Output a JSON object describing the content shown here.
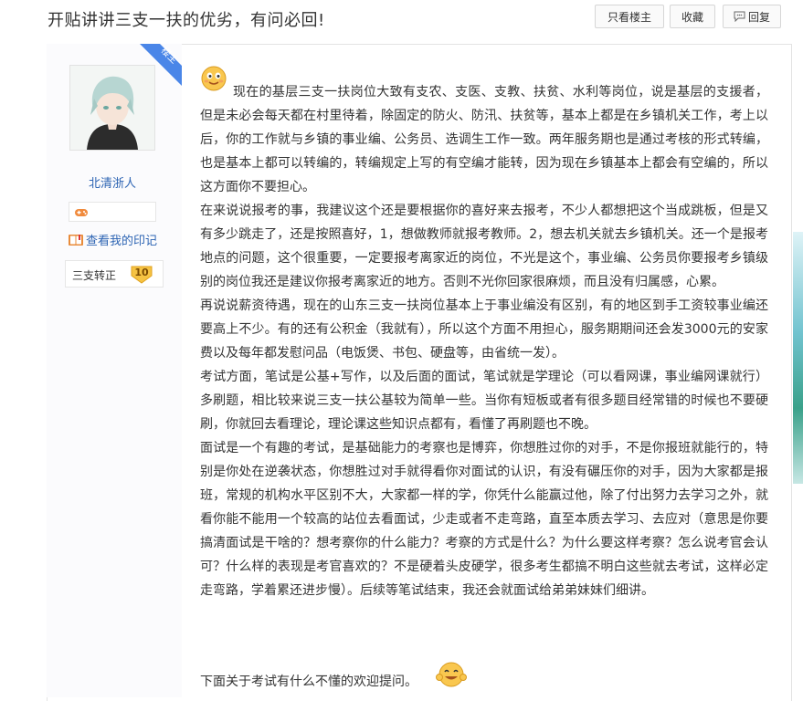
{
  "header": {
    "title": "开贴讲讲三支一扶的优劣，有问必回!",
    "only_author_label": "只看楼主",
    "favorite_label": "收藏",
    "reply_label": "回复"
  },
  "author": {
    "name": "北清浙人",
    "corner_label": "楼主",
    "marks_link": "查看我的印记",
    "badge_name": "三支转正",
    "badge_level": "10"
  },
  "post": {
    "paragraphs": [
      "现在的基层三支一扶岗位大致有支农、支医、支教、扶贫、水利等岗位，说是基层的支援者，但是未必会每天都在村里待着，除固定的防火、防汛、扶贫等，基本上都是在乡镇机关工作，考上以后，你的工作就与乡镇的事业编、公务员、选调生工作一致。两年服务期也是通过考核的形式转编，也是基本上都可以转编的，转编规定上写的有空编才能转，因为现在乡镇基本上都会有空编的，所以这方面你不要担心。",
      "在来说说报考的事，我建议这个还是要根据你的喜好来去报考，不少人都想把这个当成跳板，但是又有多少跳走了，还是按照喜好，1，想做教师就报考教师。2，想去机关就去乡镇机关。还一个是报考地点的问题，这个很重要，一定要报考离家近的岗位，不光是这个，事业编、公务员你要报考乡镇级别的岗位我还是建议你报考离家近的地方。否则不光你回家很麻烦，而且没有归属感，心累。",
      "再说说薪资待遇，现在的山东三支一扶岗位基本上于事业编没有区别，有的地区到手工资较事业编还要高上不少。有的还有公积金（我就有），所以这个方面不用担心，服务期期间还会发3000元的安家费以及每年都发慰问品（电饭煲、书包、硬盘等，由省统一发）。",
      "考试方面，笔试是公基+写作，以及后面的面试，笔试就是学理论（可以看网课，事业编网课就行）多刷题，相比较来说三支一扶公基较为简单一些。当你有短板或者有很多题目经常错的时候也不要硬刷，你就回去看理论，理论课这些知识点都有，看懂了再刷题也不晚。",
      "面试是一个有趣的考试，是基础能力的考察也是博弈，你想胜过你的对手，不是你报班就能行的，特别是你处在逆袭状态，你想胜过对手就得看你对面试的认识，有没有碾压你的对手，因为大家都是报班，常规的机构水平区别不大，大家都一样的学，你凭什么能赢过他，除了付出努力去学习之外，就看你能不能用一个较高的站位去看面试，少走或者不走弯路，直至本质去学习、去应对（意思是你要搞清面试是干啥的？想考察你的什么能力？考察的方式是什么？为什么要这样考察？怎么说考官会认可？什么样的表现是考官喜欢的？不是硬着头皮硬学，很多考生都搞不明白这些就去考试，这样必定走弯路，学着累还进步慢）。后续等笔试结束，我还会就面试给弟弟妹妹们细讲。"
    ],
    "closing": "下面关于考试有什么不懂的欢迎提问。"
  }
}
